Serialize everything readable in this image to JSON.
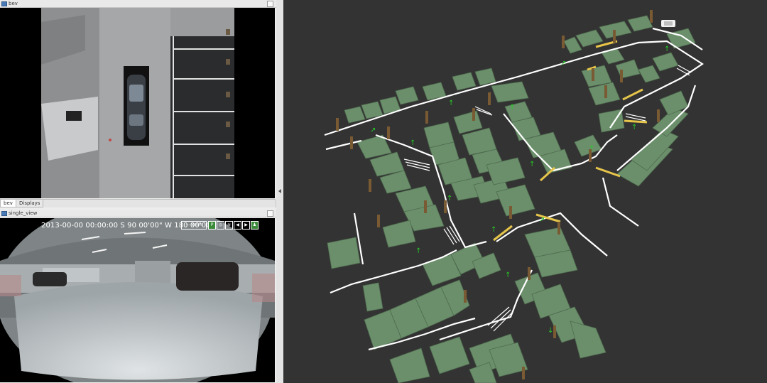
{
  "windows": {
    "bev": {
      "title": "bev"
    },
    "single_view": {
      "title": "single_view"
    }
  },
  "tabs": [
    {
      "label": "bev",
      "active": true
    },
    {
      "label": "Displays",
      "active": false
    }
  ],
  "single_view": {
    "osd_text": "2013-00-00 00:00:00    S 90 00'00\"  W 180 00'00\"",
    "osd_speed": "--- km/h",
    "osd_icons": [
      "parking-icon",
      "steering-icon",
      "lane-icon",
      "turn-left-icon",
      "turn-right-icon",
      "pedestrian-icon"
    ]
  },
  "map": {
    "background": "#333333",
    "slot_color": "#6b8f6b",
    "line_color": "#ffffff",
    "marker_color": "#e6c54a",
    "arrow_color": "#26c926",
    "post_color": "#7a5a32"
  }
}
